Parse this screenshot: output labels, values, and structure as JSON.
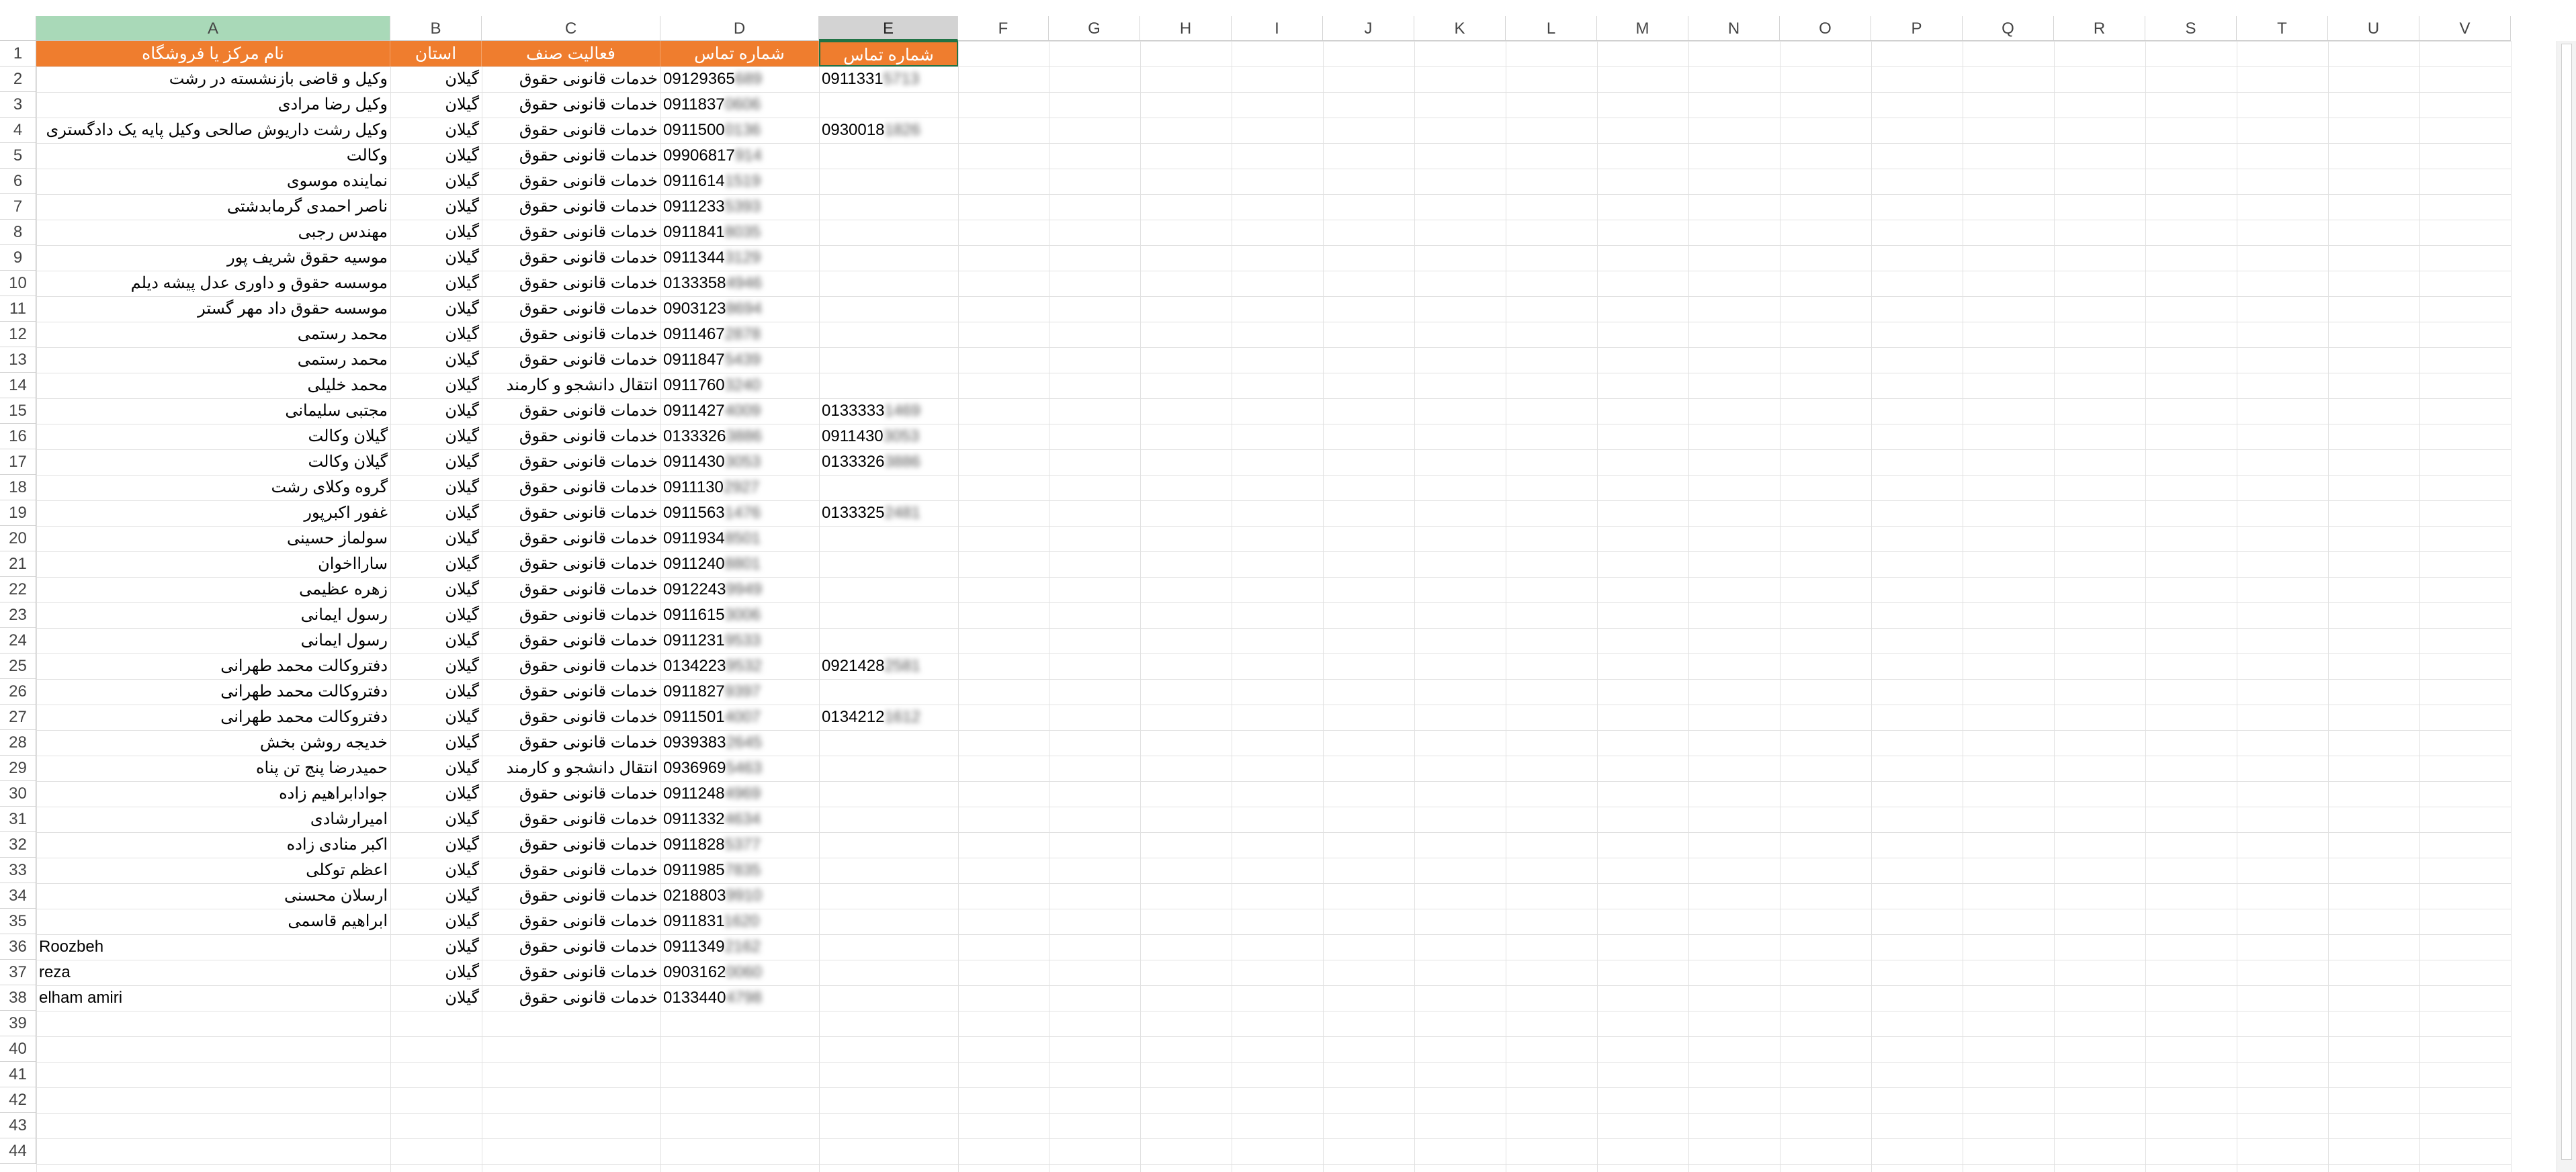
{
  "columns": [
    "A",
    "B",
    "C",
    "D",
    "E",
    "F",
    "G",
    "H",
    "I",
    "J",
    "K",
    "L",
    "M",
    "N",
    "O",
    "P",
    "Q",
    "R",
    "S",
    "T",
    "U",
    "V"
  ],
  "selected_column": "E",
  "row_numbers": [
    "1",
    "2",
    "3",
    "4",
    "5",
    "6",
    "7",
    "8",
    "9",
    "10",
    "11",
    "12",
    "13",
    "14",
    "15",
    "16",
    "17",
    "18",
    "19",
    "20",
    "21",
    "22",
    "23",
    "24",
    "25",
    "26",
    "27",
    "28",
    "29",
    "30",
    "31",
    "32",
    "33",
    "34",
    "35",
    "36",
    "37",
    "38",
    "39",
    "40",
    "41",
    "42",
    "43",
    "44"
  ],
  "header_row": {
    "A": "نام مرکز یا فروشگاه",
    "B": "استان",
    "C": "فعالیت صنف",
    "D": "شماره تماس",
    "E": "شماره تماس"
  },
  "rows": [
    {
      "name": "وکیل و قاضی بازنشسته در رشت",
      "prov": "گیلان",
      "act": "خدمات قانونی حقوق",
      "d": "09129365",
      "d_blur": "689",
      "e": "0911331",
      "e_blur": "5713",
      "name_ltr": false
    },
    {
      "name": "وکیل رضا مرادی",
      "prov": "گیلان",
      "act": "خدمات قانونی حقوق",
      "d": "0911837",
      "d_blur": "0606",
      "e": "",
      "e_blur": "",
      "name_ltr": false
    },
    {
      "name": "وکیل رشت داریوش صالحی وکیل پایه یک دادگستری",
      "prov": "گیلان",
      "act": "خدمات قانونی حقوق",
      "d": "0911500",
      "d_blur": "0136",
      "e": "0930018",
      "e_blur": "1826",
      "name_ltr": false
    },
    {
      "name": "وکالت",
      "prov": "گیلان",
      "act": "خدمات قانونی حقوق",
      "d": "09906817",
      "d_blur": "914",
      "e": "",
      "e_blur": "",
      "name_ltr": false
    },
    {
      "name": "نماینده موسوی",
      "prov": "گیلان",
      "act": "خدمات قانونی حقوق",
      "d": "0911614",
      "d_blur": "1519",
      "e": "",
      "e_blur": "",
      "name_ltr": false
    },
    {
      "name": "ناصر احمدی گرمابدشتی",
      "prov": "گیلان",
      "act": "خدمات قانونی حقوق",
      "d": "0911233",
      "d_blur": "5393",
      "e": "",
      "e_blur": "",
      "name_ltr": false
    },
    {
      "name": "مهندس رجبی",
      "prov": "گیلان",
      "act": "خدمات قانونی حقوق",
      "d": "0911841",
      "d_blur": "8035",
      "e": "",
      "e_blur": "",
      "name_ltr": false
    },
    {
      "name": "موسیه حقوق شریف پور",
      "prov": "گیلان",
      "act": "خدمات قانونی حقوق",
      "d": "0911344",
      "d_blur": "3129",
      "e": "",
      "e_blur": "",
      "name_ltr": false
    },
    {
      "name": "موسسه حقوق و داوری عدل پیشه دیلم",
      "prov": "گیلان",
      "act": "خدمات قانونی حقوق",
      "d": "0133358",
      "d_blur": "4946",
      "e": "",
      "e_blur": "",
      "name_ltr": false
    },
    {
      "name": "موسسه حقوق داد مهر گستر",
      "prov": "گیلان",
      "act": "خدمات قانونی حقوق",
      "d": "0903123",
      "d_blur": "8694",
      "e": "",
      "e_blur": "",
      "name_ltr": false
    },
    {
      "name": "محمد رستمی",
      "prov": "گیلان",
      "act": "خدمات قانونی حقوق",
      "d": "0911467",
      "d_blur": "2878",
      "e": "",
      "e_blur": "",
      "name_ltr": false
    },
    {
      "name": "محمد رستمی",
      "prov": "گیلان",
      "act": "خدمات قانونی حقوق",
      "d": "0911847",
      "d_blur": "5439",
      "e": "",
      "e_blur": "",
      "name_ltr": false
    },
    {
      "name": "محمد خلیلی",
      "prov": "گیلان",
      "act": "انتقال دانشجو و کارمند",
      "d": "0911760",
      "d_blur": "3240",
      "e": "",
      "e_blur": "",
      "name_ltr": false
    },
    {
      "name": "مجتبی سلیمانی",
      "prov": "گیلان",
      "act": "خدمات قانونی حقوق",
      "d": "0911427",
      "d_blur": "4009",
      "e": "0133333",
      "e_blur": "1469",
      "name_ltr": false
    },
    {
      "name": "گیلان وکالت",
      "prov": "گیلان",
      "act": "خدمات قانونی حقوق",
      "d": "0133326",
      "d_blur": "3886",
      "e": "0911430",
      "e_blur": "3053",
      "name_ltr": false
    },
    {
      "name": "گیلان وکالت",
      "prov": "گیلان",
      "act": "خدمات قانونی حقوق",
      "d": "0911430",
      "d_blur": "3053",
      "e": "0133326",
      "e_blur": "3886",
      "name_ltr": false
    },
    {
      "name": "گروه وکلای رشت",
      "prov": "گیلان",
      "act": "خدمات قانونی حقوق",
      "d": "0911130",
      "d_blur": "2927",
      "e": "",
      "e_blur": "",
      "name_ltr": false
    },
    {
      "name": "غفور اکبرپور",
      "prov": "گیلان",
      "act": "خدمات قانونی حقوق",
      "d": "0911563",
      "d_blur": "1476",
      "e": "0133325",
      "e_blur": "2481",
      "name_ltr": false
    },
    {
      "name": "سولماز حسینی",
      "prov": "گیلان",
      "act": "خدمات قانونی حقوق",
      "d": "0911934",
      "d_blur": "8501",
      "e": "",
      "e_blur": "",
      "name_ltr": false
    },
    {
      "name": "سارااخوان",
      "prov": "گیلان",
      "act": "خدمات قانونی حقوق",
      "d": "0911240",
      "d_blur": "8801",
      "e": "",
      "e_blur": "",
      "name_ltr": false
    },
    {
      "name": "زهره عظیمی",
      "prov": "گیلان",
      "act": "خدمات قانونی حقوق",
      "d": "0912243",
      "d_blur": "9949",
      "e": "",
      "e_blur": "",
      "name_ltr": false
    },
    {
      "name": "رسول ایمانی",
      "prov": "گیلان",
      "act": "خدمات قانونی حقوق",
      "d": "0911615",
      "d_blur": "3006",
      "e": "",
      "e_blur": "",
      "name_ltr": false
    },
    {
      "name": "رسول ایمانی",
      "prov": "گیلان",
      "act": "خدمات قانونی حقوق",
      "d": "0911231",
      "d_blur": "9533",
      "e": "",
      "e_blur": "",
      "name_ltr": false
    },
    {
      "name": "دفتروکالت محمد طهرانی",
      "prov": "گیلان",
      "act": "خدمات قانونی حقوق",
      "d": "0134223",
      "d_blur": "9532",
      "e": "0921428",
      "e_blur": "2581",
      "name_ltr": false
    },
    {
      "name": "دفتروکالت محمد طهرانی",
      "prov": "گیلان",
      "act": "خدمات قانونی حقوق",
      "d": "0911827",
      "d_blur": "9397",
      "e": "",
      "e_blur": "",
      "name_ltr": false
    },
    {
      "name": "دفتروکالت محمد طهرانی",
      "prov": "گیلان",
      "act": "خدمات قانونی حقوق",
      "d": "0911501",
      "d_blur": "4007",
      "e": "0134212",
      "e_blur": "1612",
      "name_ltr": false
    },
    {
      "name": "خدیجه روشن بخش",
      "prov": "گیلان",
      "act": "خدمات قانونی حقوق",
      "d": "0939383",
      "d_blur": "2645",
      "e": "",
      "e_blur": "",
      "name_ltr": false
    },
    {
      "name": "حمیدرضا پنج تن پناه",
      "prov": "گیلان",
      "act": "انتقال دانشجو و کارمند",
      "d": "0936969",
      "d_blur": "5463",
      "e": "",
      "e_blur": "",
      "name_ltr": false
    },
    {
      "name": "جوادابراهیم زاده",
      "prov": "گیلان",
      "act": "خدمات قانونی حقوق",
      "d": "0911248",
      "d_blur": "4969",
      "e": "",
      "e_blur": "",
      "name_ltr": false
    },
    {
      "name": "امیرارشادی",
      "prov": "گیلان",
      "act": "خدمات قانونی حقوق",
      "d": "0911332",
      "d_blur": "4634",
      "e": "",
      "e_blur": "",
      "name_ltr": false
    },
    {
      "name": "اکبر منادی زاده",
      "prov": "گیلان",
      "act": "خدمات قانونی حقوق",
      "d": "0911828",
      "d_blur": "5377",
      "e": "",
      "e_blur": "",
      "name_ltr": false
    },
    {
      "name": "اعظم توکلی",
      "prov": "گیلان",
      "act": "خدمات قانونی حقوق",
      "d": "0911985",
      "d_blur": "7835",
      "e": "",
      "e_blur": "",
      "name_ltr": false
    },
    {
      "name": "ارسلان محسنی",
      "prov": "گیلان",
      "act": "خدمات قانونی حقوق",
      "d": "0218803",
      "d_blur": "9910",
      "e": "",
      "e_blur": "",
      "name_ltr": false
    },
    {
      "name": "ابراهیم قاسمی",
      "prov": "گیلان",
      "act": "خدمات قانونی حقوق",
      "d": "0911831",
      "d_blur": "1620",
      "e": "",
      "e_blur": "",
      "name_ltr": false
    },
    {
      "name": "Roozbeh",
      "prov": "گیلان",
      "act": "خدمات قانونی حقوق",
      "d": "0911349",
      "d_blur": "2162",
      "e": "",
      "e_blur": "",
      "name_ltr": true
    },
    {
      "name": "reza",
      "prov": "گیلان",
      "act": "خدمات قانونی حقوق",
      "d": "0903162",
      "d_blur": "0060",
      "e": "",
      "e_blur": "",
      "name_ltr": true
    },
    {
      "name": "elham amiri",
      "prov": "گیلان",
      "act": "خدمات قانونی حقوق",
      "d": "0133440",
      "d_blur": "4798",
      "e": "",
      "e_blur": "",
      "name_ltr": true
    }
  ],
  "colors": {
    "header_fill": "#ef7d2e",
    "header_text": "#ffffff",
    "selection_green": "#217346",
    "column_a_header_fill": "#a9d9b8"
  }
}
